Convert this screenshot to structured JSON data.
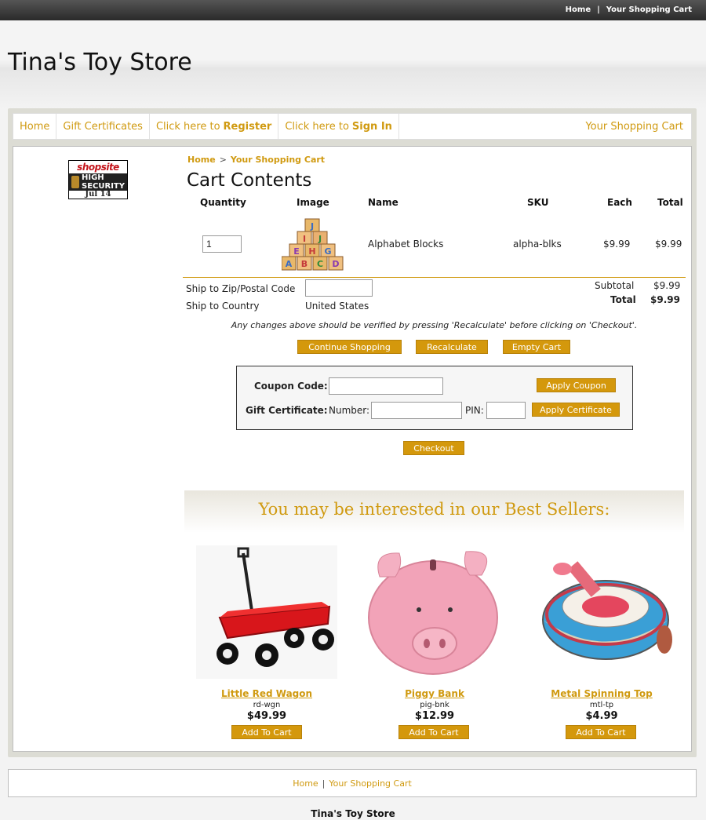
{
  "topbar": {
    "home": "Home",
    "sep": "|",
    "cart": "Your Shopping Cart"
  },
  "store": {
    "title": "Tina's Toy Store"
  },
  "nav": {
    "home": "Home",
    "gift": "Gift Certificates",
    "register_prefix": "Click here to",
    "register_bold": "Register",
    "signin_prefix": "Click here to",
    "signin_bold": "Sign In",
    "cart": "Your Shopping Cart"
  },
  "badge": {
    "brand": "shopsite",
    "line1": "HIGH",
    "line2": "SECURITY",
    "date": "Jul 14"
  },
  "breadcrumb": {
    "home": "Home",
    "sep": ">",
    "current": "Your Shopping Cart"
  },
  "cart": {
    "title": "Cart Contents",
    "headers": {
      "quantity": "Quantity",
      "image": "Image",
      "name": "Name",
      "sku": "SKU",
      "each": "Each",
      "total": "Total"
    },
    "item": {
      "quantity": "1",
      "name": "Alphabet Blocks",
      "sku": "alpha-blks",
      "each": "$9.99",
      "total": "$9.99"
    },
    "ship_zip_label": "Ship to Zip/Postal Code",
    "ship_zip_value": "",
    "ship_country_label": "Ship to Country",
    "ship_country_value": "United States",
    "subtotal_label": "Subtotal",
    "subtotal_value": "$9.99",
    "total_label": "Total",
    "total_value": "$9.99",
    "note": "Any changes above should be verified by pressing 'Recalculate' before clicking on 'Checkout'."
  },
  "buttons": {
    "continue": "Continue Shopping",
    "recalculate": "Recalculate",
    "empty": "Empty Cart",
    "apply_coupon": "Apply Coupon",
    "apply_certificate": "Apply Certificate",
    "checkout": "Checkout",
    "add_to_cart": "Add To Cart"
  },
  "coupon": {
    "coupon_label": "Coupon Code:",
    "gift_label": "Gift Certificate:",
    "number_label": "Number:",
    "pin_label": "PIN:"
  },
  "bestsellers": {
    "title": "You may be interested in our Best Sellers:",
    "products": [
      {
        "name": "Little Red Wagon",
        "sku": "rd-wgn",
        "price": "$49.99"
      },
      {
        "name": "Piggy Bank",
        "sku": "pig-bnk",
        "price": "$12.99"
      },
      {
        "name": "Metal Spinning Top",
        "sku": "mtl-tp",
        "price": "$4.99"
      }
    ]
  },
  "footer": {
    "home": "Home",
    "sep": "|",
    "cart": "Your Shopping Cart",
    "store": "Tina's Toy Store"
  }
}
